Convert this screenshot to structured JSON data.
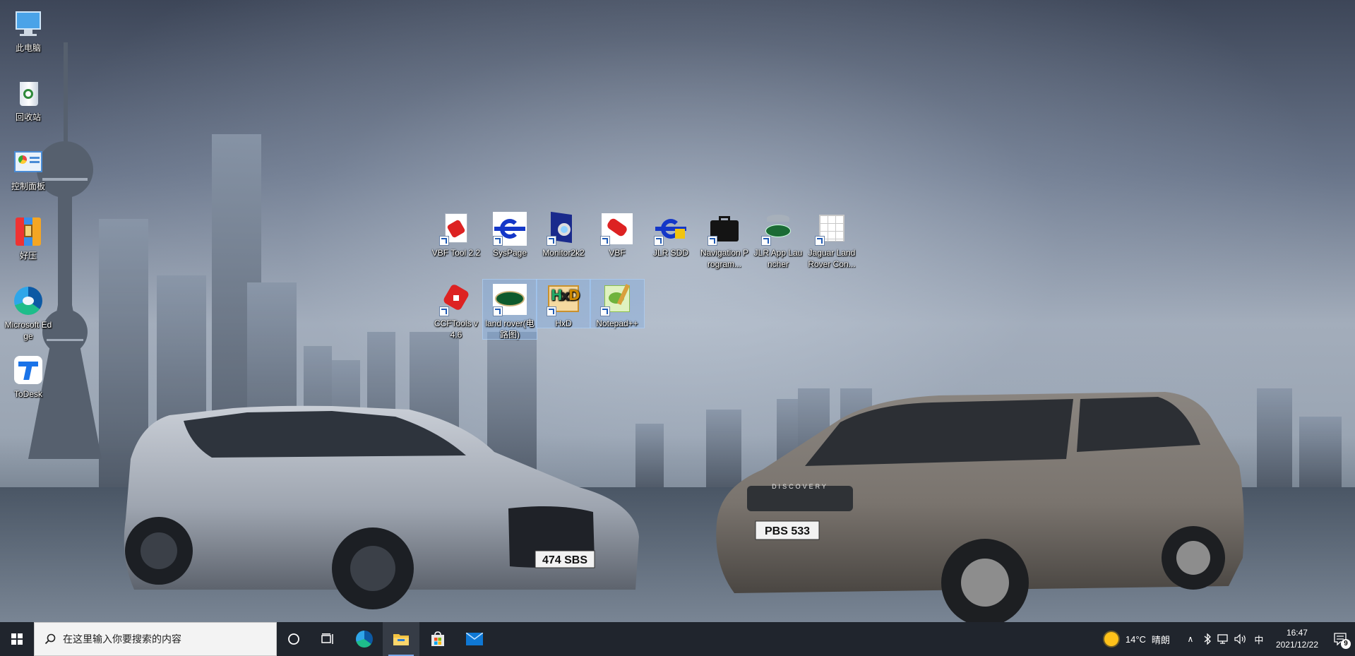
{
  "desktop": {
    "left_icons": [
      {
        "label": "此电脑",
        "icon": "this-pc-icon"
      },
      {
        "label": "回收站",
        "icon": "recycle-bin-icon"
      },
      {
        "label": "控制面板",
        "icon": "control-panel-icon"
      },
      {
        "label": "好压",
        "icon": "haozip-icon"
      },
      {
        "label": "Microsoft Edge",
        "icon": "edge-icon"
      },
      {
        "label": "ToDesk",
        "icon": "todesk-icon"
      }
    ],
    "center_icons_row1": [
      {
        "label": "VBF Tool 2.2",
        "icon": "vbf-tool-icon"
      },
      {
        "label": "SysPage",
        "icon": "syspage-icon"
      },
      {
        "label": "Monitor2k2",
        "icon": "monitor2k2-icon"
      },
      {
        "label": "VBF",
        "icon": "vbf-icon"
      },
      {
        "label": "JLR SDD",
        "icon": "jlr-sdd-icon"
      },
      {
        "label": "Navigation Program...",
        "icon": "briefcase-icon"
      },
      {
        "label": "JLR App Launcher",
        "icon": "jlr-app-launcher-icon"
      },
      {
        "label": "Jaguar Land Rover Con...",
        "icon": "jlr-config-icon"
      }
    ],
    "center_icons_row2": [
      {
        "label": "CCFTools v4.6",
        "icon": "ccftools-icon",
        "selected": false
      },
      {
        "label": "land rover(电路图)",
        "icon": "land-rover-logo-icon",
        "selected": true
      },
      {
        "label": "HxD",
        "icon": "hxd-icon",
        "selected": true
      },
      {
        "label": "Notepad++",
        "icon": "notepadpp-icon",
        "selected": true
      }
    ],
    "wallpaper": {
      "plate_left": "474 SBS",
      "plate_right": "PBS 533",
      "grille_text": "DISCOVERY"
    }
  },
  "taskbar": {
    "search_placeholder": "在这里输入你要搜索的内容",
    "pinned": [
      "task-view-icon",
      "edge-icon",
      "file-explorer-icon",
      "store-icon",
      "mail-icon"
    ],
    "weather_temp": "14°C",
    "weather_text": "晴朗",
    "ime": "中",
    "time": "16:47",
    "date": "2021/12/22",
    "notification_count": "9",
    "accent": "#7aa7e8",
    "background": "#20252d"
  }
}
